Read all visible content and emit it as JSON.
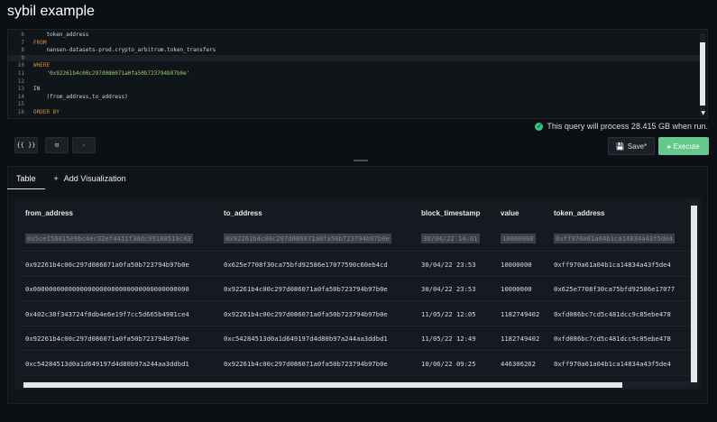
{
  "app": {
    "title": "sybil example"
  },
  "editor": {
    "lines": [
      {
        "num": "6",
        "text": "    token_address",
        "kind": "plain"
      },
      {
        "num": "7",
        "text": "FROM",
        "kind": "kw"
      },
      {
        "num": "8",
        "text": "    nansen-datasets-prod.crypto_arbitrum.token_transfers",
        "kind": "plain"
      },
      {
        "num": "9",
        "text": "",
        "kind": "active"
      },
      {
        "num": "10",
        "text": "WHERE",
        "kind": "kw"
      },
      {
        "num": "11",
        "text": "    '0x92261b4c00c297d086071a0fa50b723794b97b0e'",
        "kind": "str"
      },
      {
        "num": "12",
        "text": "",
        "kind": "plain"
      },
      {
        "num": "13",
        "text": "IN",
        "kind": "plain"
      },
      {
        "num": "14",
        "text": "    (from_address,to_address)",
        "kind": "plain"
      },
      {
        "num": "15",
        "text": "",
        "kind": "plain"
      },
      {
        "num": "16",
        "text": "ORDER BY",
        "kind": "kw"
      }
    ]
  },
  "info": {
    "text": "This query will process 28.415 GB when run."
  },
  "toolbar": {
    "format_label": "{{ }}",
    "panel_label": "⊡",
    "pin_label": "✦",
    "save_label": "Save*",
    "save_icon": "floppy-icon",
    "execute_label": "▸ Execute"
  },
  "results": {
    "tabs": [
      {
        "label": "Table"
      },
      {
        "label": "Add Visualization"
      }
    ],
    "columns": [
      "from_address",
      "to_address",
      "block_timestamp",
      "value",
      "token_address"
    ],
    "rows": [
      [
        "0x5ce150015e9bc4ec32ef4411f30dc99180519c43",
        "0x92261b4c00c297d086071a0fa50b723794b97b0e",
        "30/04/22 14:01",
        "10000000",
        "0xff970a61a04b1ca14834a43f5de4"
      ],
      [
        "0x92261b4c00c297d086071a0fa50b723794b97b0e",
        "0x625e7708f30ca75bfd92586e17077590c60eb4cd",
        "30/04/22 23:53",
        "10000000",
        "0xff970a61a04b1ca14834a43f5de4"
      ],
      [
        "0x0000000000000000000000000000000000000000",
        "0x92261b4c00c297d086071a0fa50b723794b97b0e",
        "30/04/22 23:53",
        "10000000",
        "0x625e7708f30ca75bfd92586e17077"
      ],
      [
        "0x402c38f343724f0db4e6e19f7cc5d665b4981ce4",
        "0x92261b4c00c297d086071a0fa50b723794b97b0e",
        "11/05/22 12:05",
        "1182749402",
        "0xfd086bc7cd5c481dcc9c85ebe478"
      ],
      [
        "0x92261b4c00c297d086071a0fa50b723794b97b0e",
        "0xc54284513d0a1d649197d4d80b97a244aa3ddbd1",
        "11/05/22 12:49",
        "1182749402",
        "0xfd086bc7cd5c481dcc9c85ebe478"
      ],
      [
        "0xc54284513d0a1d649197d4d80b97a244aa3ddbd1",
        "0x92261b4c00c297d086071a0fa50b723794b97b0e",
        "10/06/22 09:25",
        "446306262",
        "0xff970a61a04b1ca14834a43f5de4"
      ]
    ]
  }
}
